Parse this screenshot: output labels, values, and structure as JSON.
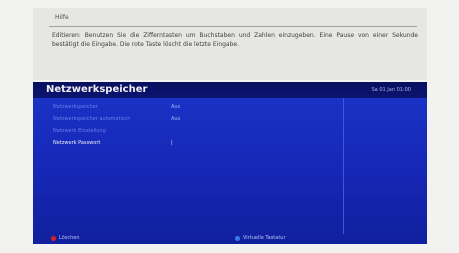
{
  "help": {
    "title": "Hilfe",
    "text": "Editieren: Benutzen Sie die Zifferntasten um Buchstaben und Zahlen einzugeben. Eine Pause von einer Sekunde bestätigt die Eingabe. Die rote Taste löscht die letzte Eingabe."
  },
  "panel": {
    "title": "Netzwerkspeicher",
    "date": "Sa 01 Jan 01:00",
    "rows": [
      {
        "label": "Netzwerkspeicher",
        "value": "Aus"
      },
      {
        "label": "Netzwerkspeicher automatisch",
        "value": "Aus"
      },
      {
        "label": "Netzwerk Einstellung",
        "value": ""
      },
      {
        "label": "Netzwerk Passwort",
        "value": "|"
      }
    ]
  },
  "footer": {
    "red_label": "Löschen",
    "blue_label": "Virtuelle Tastatur"
  },
  "colors": {
    "panel_blue": "#1628b8",
    "header_dark": "#08105e",
    "red_key": "#d82020",
    "blue_key": "#3a7af0"
  }
}
